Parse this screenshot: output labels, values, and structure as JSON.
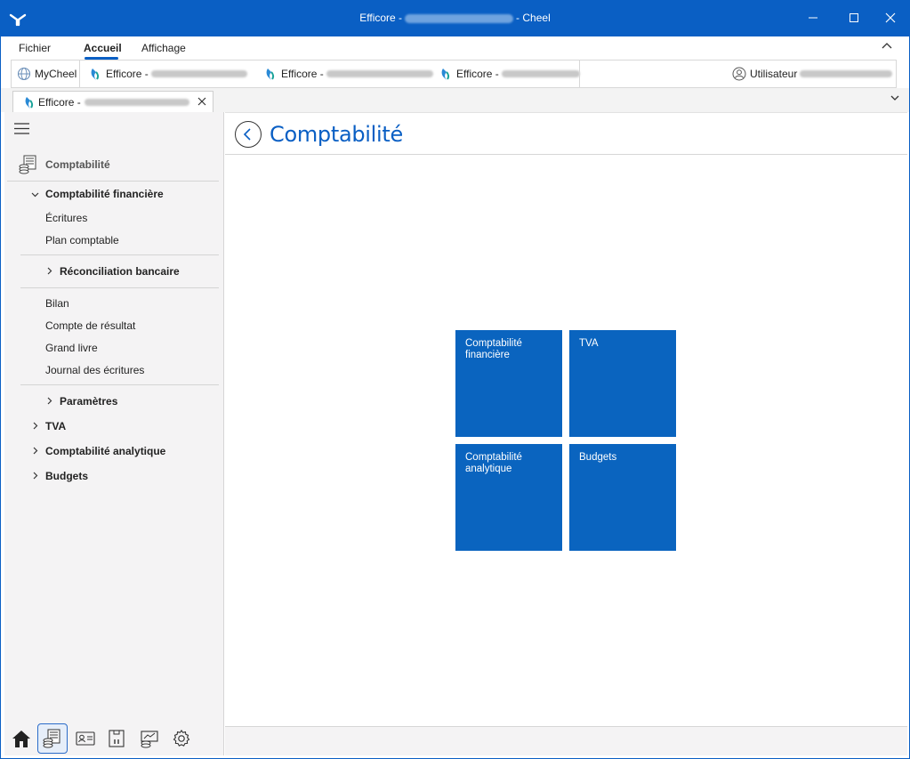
{
  "window": {
    "title_prefix": "Efficore -",
    "title_suffix": "- Cheel",
    "accent_color": "#0a5fc4"
  },
  "ribbon": {
    "menu": [
      "Fichier",
      "Accueil",
      "Affichage"
    ],
    "active": "Accueil"
  },
  "quick_tabs": {
    "mycheel": "MyCheel",
    "efficore_1": "Efficore -",
    "efficore_2": "Efficore -",
    "efficore_3": "Efficore -",
    "user_label": "Utilisateur"
  },
  "doc_tab": {
    "label": "Efficore -"
  },
  "sidebar": {
    "section_title": "Comptabilité",
    "group_financiere": "Comptabilité financière",
    "items_financiere": [
      "Écritures",
      "Plan comptable"
    ],
    "reconciliation": "Réconciliation bancaire",
    "items_reports": [
      "Bilan",
      "Compte de résultat",
      "Grand livre",
      "Journal des écritures"
    ],
    "parametres": "Paramètres",
    "tva": "TVA",
    "analytique": "Comptabilité analytique",
    "budgets": "Budgets"
  },
  "main": {
    "title": "Comptabilité",
    "tiles": [
      {
        "line1": "Comptabilité",
        "line2": "financière"
      },
      {
        "line1": "TVA",
        "line2": ""
      },
      {
        "line1": "Comptabilité",
        "line2": "analytique"
      },
      {
        "line1": "Budgets",
        "line2": ""
      }
    ],
    "tile_color": "#0a64bf"
  },
  "icons": {
    "bottom_bar": [
      "home-icon",
      "accounting-icon",
      "contacts-icon",
      "document-icon",
      "coins-icon",
      "settings-icon"
    ]
  }
}
